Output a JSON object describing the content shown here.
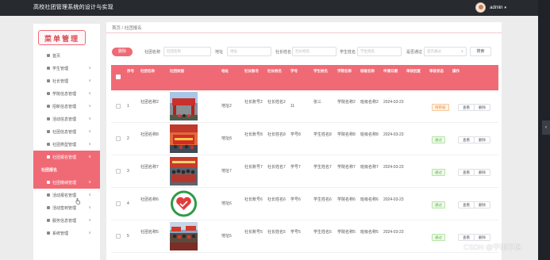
{
  "header": {
    "app_title": "高校社团管理系统的设计与实现",
    "admin_name": "admin",
    "caret": "▾",
    "edge_handle": "‹"
  },
  "sidebar": {
    "menu_title": "菜单管理",
    "items": [
      {
        "label": "首页",
        "icon": "home-icon",
        "has_chevron": false
      },
      {
        "label": "学生管理",
        "icon": "grid-icon",
        "has_chevron": true
      },
      {
        "label": "社长管理",
        "icon": "grid-icon",
        "has_chevron": true
      },
      {
        "label": "学院信息管理",
        "icon": "grid-icon",
        "has_chevron": true
      },
      {
        "label": "招新信息管理",
        "icon": "grid-icon",
        "has_chevron": true
      },
      {
        "label": "活动信息管理",
        "icon": "grid-icon",
        "has_chevron": true
      },
      {
        "label": "社团信息管理",
        "icon": "grid-icon",
        "has_chevron": true
      },
      {
        "label": "社团类型管理",
        "icon": "grid-icon",
        "has_chevron": true
      },
      {
        "label": "社团报名管理",
        "icon": "grid-icon",
        "has_chevron": true,
        "active": true
      },
      {
        "label": "社团报名",
        "sub": true
      },
      {
        "label": "社团缴纳管理",
        "icon": "grid-icon",
        "has_chevron": true,
        "active": true
      },
      {
        "label": "活动报名管理",
        "icon": "grid-icon",
        "has_chevron": true
      },
      {
        "label": "活动签到管理",
        "icon": "grid-icon",
        "has_chevron": true
      },
      {
        "label": "服务信息管理",
        "icon": "location-icon",
        "has_chevron": true
      },
      {
        "label": "系统管理",
        "icon": "user-icon",
        "has_chevron": true
      }
    ],
    "chevron": "∨"
  },
  "breadcrumb": "首页 / 社团报名",
  "search": {
    "delete_label": "删除",
    "club_name_label": "社团名称",
    "club_name_placeholder": "社团名称",
    "address_label": "地址",
    "address_placeholder": "地址",
    "leader_name_label": "社长姓名",
    "leader_name_placeholder": "社长姓名",
    "student_name_label": "学生姓名",
    "student_name_placeholder": "学生姓名",
    "approved_label": "是否通过",
    "approved_placeholder": "是否通过",
    "search_button": "搜索"
  },
  "table": {
    "headers": [
      "序号",
      "社团名称",
      "社团封面",
      "地址",
      "社长账号",
      "社长姓名",
      "学号",
      "学生姓名",
      "学院名称",
      "班级名称",
      "申请日期",
      "审核回复",
      "审核状态",
      "操作"
    ],
    "view_label": "查看",
    "delete_label": "删除",
    "rows": [
      {
        "index": "1",
        "club_name": "社团名称2",
        "address": "地址2",
        "leader_account": "社长账号2",
        "leader_name": "社长姓名2",
        "student_no": "11",
        "student_name": "张三",
        "college": "学院名称2",
        "class_name": "班级名称2",
        "apply_date": "2024-03-23",
        "reply": "",
        "status": "待审核",
        "status_type": "pending",
        "photo": "gate"
      },
      {
        "index": "2",
        "club_name": "社团名称8",
        "address": "地址8",
        "leader_account": "社长账号8",
        "leader_name": "社长姓名8",
        "student_no": "学号8",
        "student_name": "学生姓名8",
        "college": "学院名称8",
        "class_name": "班级名称8",
        "apply_date": "2024-03-23",
        "reply": "",
        "status": "通过",
        "status_type": "pass",
        "photo": "banner"
      },
      {
        "index": "3",
        "club_name": "社团名称7",
        "address": "地址7",
        "leader_account": "社长账号7",
        "leader_name": "社长姓名7",
        "student_no": "学号7",
        "student_name": "学生姓名7",
        "college": "学院名称7",
        "class_name": "班级名称7",
        "apply_date": "2024-03-23",
        "reply": "",
        "status": "通过",
        "status_type": "pass",
        "photo": "group"
      },
      {
        "index": "4",
        "club_name": "社团名称6",
        "address": "地址6",
        "leader_account": "社长账号6",
        "leader_name": "社长姓名6",
        "student_no": "学号6",
        "student_name": "学生姓名6",
        "college": "学院名称6",
        "class_name": "班级名称6",
        "apply_date": "2024-03-23",
        "reply": "",
        "status": "通过",
        "status_type": "pass",
        "photo": "logo"
      },
      {
        "index": "5",
        "club_name": "社团名称5",
        "address": "地址5",
        "leader_account": "社长账号5",
        "leader_name": "社长姓名5",
        "student_no": "学号5",
        "student_name": "学生姓名5",
        "college": "学院名称5",
        "class_name": "班级名称5",
        "apply_date": "2024-03-23",
        "reply": "",
        "status": "通过",
        "status_type": "pass",
        "photo": "crowd"
      }
    ]
  },
  "watermark": "CSDN @宇雨学姐",
  "colors": {
    "accent": "#f06a75",
    "topbar": "#272b2f",
    "pending": "#e6893a",
    "pass": "#5bb04a"
  }
}
